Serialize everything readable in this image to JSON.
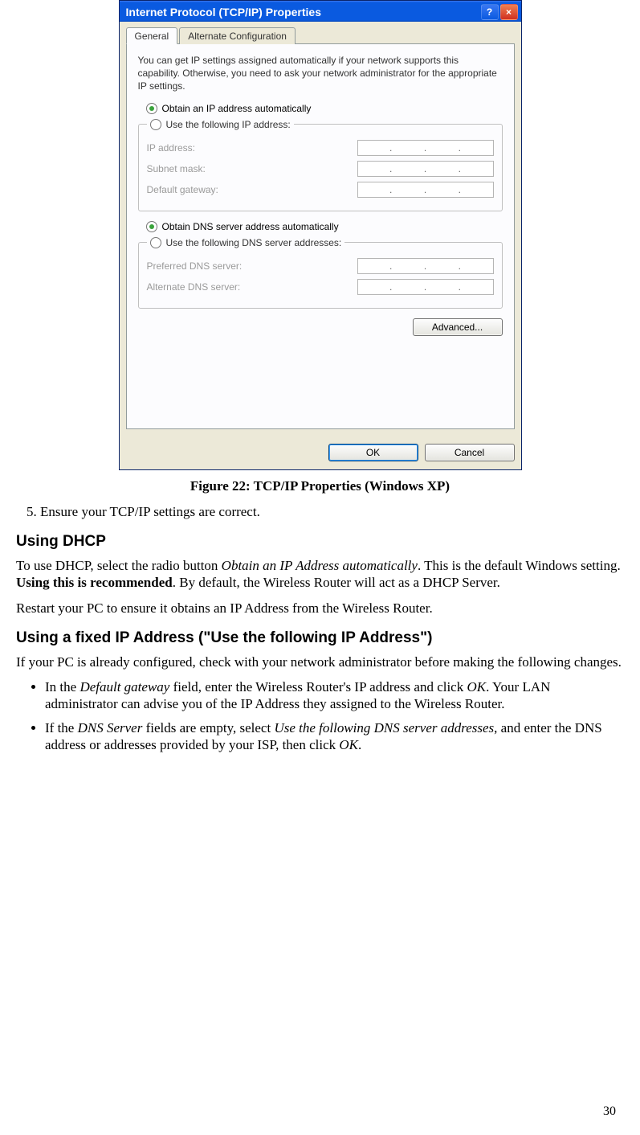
{
  "dialog": {
    "title": "Internet Protocol (TCP/IP) Properties",
    "tabs": {
      "general": "General",
      "alt": "Alternate Configuration"
    },
    "intro": "You can get IP settings assigned automatically if your network supports this capability. Otherwise, you need to ask your network administrator for the appropriate IP settings.",
    "radio_auto_ip": "Obtain an IP address automatically",
    "radio_manual_ip": "Use the following IP address:",
    "ip_label": "IP address:",
    "subnet_label": "Subnet mask:",
    "gateway_label": "Default gateway:",
    "radio_auto_dns": "Obtain DNS server address automatically",
    "radio_manual_dns": "Use the following DNS server addresses:",
    "preferred_dns_label": "Preferred DNS server:",
    "alternate_dns_label": "Alternate DNS server:",
    "advanced_btn": "Advanced...",
    "ok_btn": "OK",
    "cancel_btn": "Cancel"
  },
  "caption": "Figure 22: TCP/IP Properties (Windows XP)",
  "step_text": "Ensure your TCP/IP settings are correct.",
  "h_dhcp": "Using DHCP",
  "p_dhcp_1a": "To use DHCP, select the radio button ",
  "p_dhcp_1b": "Obtain an IP Address automatically",
  "p_dhcp_1c": ". This is the default Windows setting. ",
  "p_dhcp_1d": "Using this is recommended",
  "p_dhcp_1e": ". By default, the Wireless Router will act as a DHCP Server.",
  "p_dhcp_2": "Restart your PC to ensure it obtains an IP Address from the Wireless Router.",
  "h_fixed": "Using a fixed IP Address (\"Use the following IP Address\")",
  "p_fixed_1": "If your PC is already configured, check with your network administrator before making the following changes.",
  "li1_a": "In the ",
  "li1_b": "Default gateway",
  "li1_c": " field, enter the Wireless Router's IP address and click ",
  "li1_d": "OK",
  "li1_e": ". Your LAN administrator can advise you of the IP Address they assigned to the Wireless Router.",
  "li2_a": "If the ",
  "li2_b": "DNS Server",
  "li2_c": " fields are empty, select ",
  "li2_d": "Use the following DNS server addresses",
  "li2_e": ", and enter the DNS address or addresses provided by your ISP, then click ",
  "li2_f": "OK",
  "li2_g": ".",
  "page_number": "30"
}
